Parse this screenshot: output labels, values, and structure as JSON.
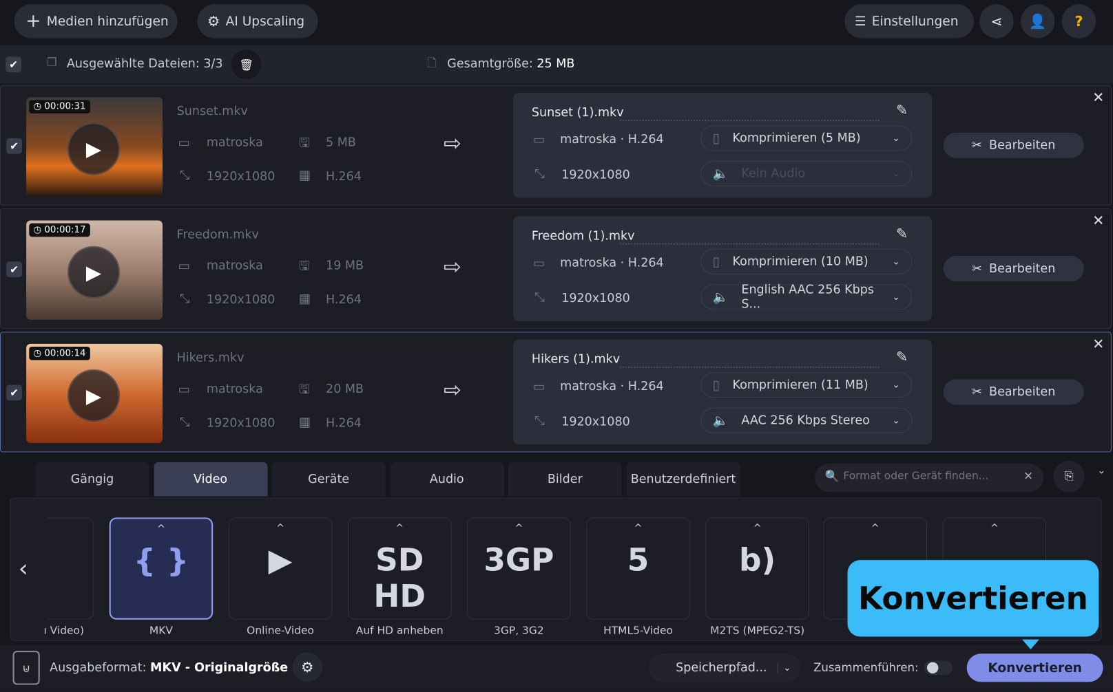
{
  "toolbar": {
    "add_media": "Medien hinzufügen",
    "ai_upscaling": "AI Upscaling",
    "settings": "Einstellungen",
    "help": "?"
  },
  "selection": {
    "selected": "Ausgewählte Dateien: 3/3",
    "total_label": "Gesamtgröße:",
    "total_value": "25 MB"
  },
  "files": [
    {
      "duration": "00:00:31",
      "name": "Sunset.mkv",
      "container": "matroska",
      "size": "5 MB",
      "resolution": "1920x1080",
      "codec": "H.264",
      "out_name": "Sunset (1).mkv",
      "out_format": "matroska · H.264",
      "out_resolution": "1920x1080",
      "compress": "Komprimieren (5 MB)",
      "audio": "Kein Audio",
      "audio_disabled": true,
      "edit": "Bearbeiten"
    },
    {
      "duration": "00:00:17",
      "name": "Freedom.mkv",
      "container": "matroska",
      "size": "19 MB",
      "resolution": "1920x1080",
      "codec": "H.264",
      "out_name": "Freedom (1).mkv",
      "out_format": "matroska · H.264",
      "out_resolution": "1920x1080",
      "compress": "Komprimieren (10 MB)",
      "audio": "English AAC 256 Kbps S...",
      "audio_disabled": false,
      "edit": "Bearbeiten"
    },
    {
      "duration": "00:00:14",
      "name": "Hikers.mkv",
      "container": "matroska",
      "size": "20 MB",
      "resolution": "1920x1080",
      "codec": "H.264",
      "out_name": "Hikers (1).mkv",
      "out_format": "matroska · H.264",
      "out_resolution": "1920x1080",
      "compress": "Komprimieren (11 MB)",
      "audio": "AAC 256 Kbps Stereo",
      "audio_disabled": false,
      "edit": "Bearbeiten"
    }
  ],
  "tabs": [
    "Gängig",
    "Video",
    "Geräte",
    "Audio",
    "Bilder",
    "Benutzerdefiniert"
  ],
  "active_tab": "Video",
  "search": {
    "placeholder": "Format oder Gerät finden..."
  },
  "formats": [
    {
      "label": "MKV",
      "glyph": "{ }"
    },
    {
      "label": "Online-Video",
      "glyph": "▶"
    },
    {
      "label": "Auf HD anheben",
      "glyph": "SD HD"
    },
    {
      "label": "3GP, 3G2",
      "glyph": "3GP"
    },
    {
      "label": "HTML5-Video",
      "glyph": "5"
    },
    {
      "label": "M2TS (MPEG2-TS)",
      "glyph": "b)"
    }
  ],
  "partial_format_label": "ı Video)",
  "footer": {
    "output_label": "Ausgabeformat:",
    "output_value": "MKV - Originalgröße",
    "save_path": "Speicherpfad...",
    "merge": "Zusammenführen:",
    "convert": "Konvertieren"
  },
  "tooltip": "Konvertieren"
}
